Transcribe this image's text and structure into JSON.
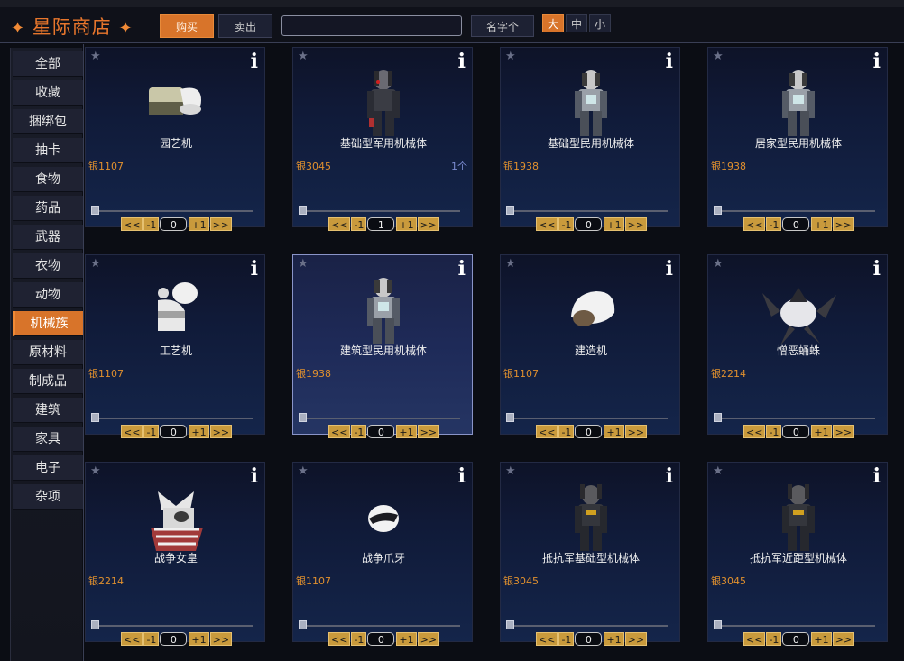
{
  "header": {
    "title": "星际商店",
    "buy_label": "购买",
    "sell_label": "卖出",
    "search_value": "",
    "sort_label": "名字个",
    "size_large": "大",
    "size_medium": "中",
    "size_small": "小"
  },
  "sidebar": {
    "items": [
      {
        "label": "全部"
      },
      {
        "label": "收藏"
      },
      {
        "label": "捆绑包"
      },
      {
        "label": "抽卡"
      },
      {
        "label": "食物"
      },
      {
        "label": "药品"
      },
      {
        "label": "武器"
      },
      {
        "label": "衣物"
      },
      {
        "label": "动物"
      },
      {
        "label": "机械族",
        "active": true
      },
      {
        "label": "原材料"
      },
      {
        "label": "制成品"
      },
      {
        "label": "建筑"
      },
      {
        "label": "家具"
      },
      {
        "label": "电子"
      },
      {
        "label": "杂项"
      }
    ]
  },
  "controls": {
    "fav": "★",
    "info": "i",
    "first": "<<",
    "minus": "-1",
    "plus": "+1",
    "last": ">>"
  },
  "items": [
    {
      "name": "园艺机",
      "price": "银1107",
      "owned": "",
      "qty": "0",
      "icon": "gardener-mech-icon"
    },
    {
      "name": "基础型军用机械体",
      "price": "银3045",
      "owned": "1个",
      "qty": "1",
      "icon": "military-mechanoid-icon"
    },
    {
      "name": "基础型民用机械体",
      "price": "银1938",
      "owned": "",
      "qty": "0",
      "icon": "civilian-mechanoid-icon"
    },
    {
      "name": "居家型民用机械体",
      "price": "银1938",
      "owned": "",
      "qty": "0",
      "icon": "household-mechanoid-icon"
    },
    {
      "name": "工艺机",
      "price": "银1107",
      "owned": "",
      "qty": "0",
      "icon": "crafter-mech-icon"
    },
    {
      "name": "建筑型民用机械体",
      "price": "银1938",
      "owned": "",
      "qty": "0",
      "icon": "construction-mechanoid-icon",
      "selected": true
    },
    {
      "name": "建造机",
      "price": "银1107",
      "owned": "",
      "qty": "0",
      "icon": "builder-mech-icon"
    },
    {
      "name": "憎恶蛹蛛",
      "price": "银2214",
      "owned": "",
      "qty": "0",
      "icon": "spider-mech-icon"
    },
    {
      "name": "战争女皇",
      "price": "银2214",
      "owned": "",
      "qty": "0",
      "icon": "war-queen-icon"
    },
    {
      "name": "战争爪牙",
      "price": "银1107",
      "owned": "",
      "qty": "0",
      "icon": "war-urchin-icon"
    },
    {
      "name": "抵抗军基础型机械体",
      "price": "银3045",
      "owned": "",
      "qty": "0",
      "icon": "resistance-mechanoid-icon"
    },
    {
      "name": "抵抗军近距型机械体",
      "price": "银3045",
      "owned": "",
      "qty": "0",
      "icon": "resistance-melee-mechanoid-icon"
    }
  ]
}
